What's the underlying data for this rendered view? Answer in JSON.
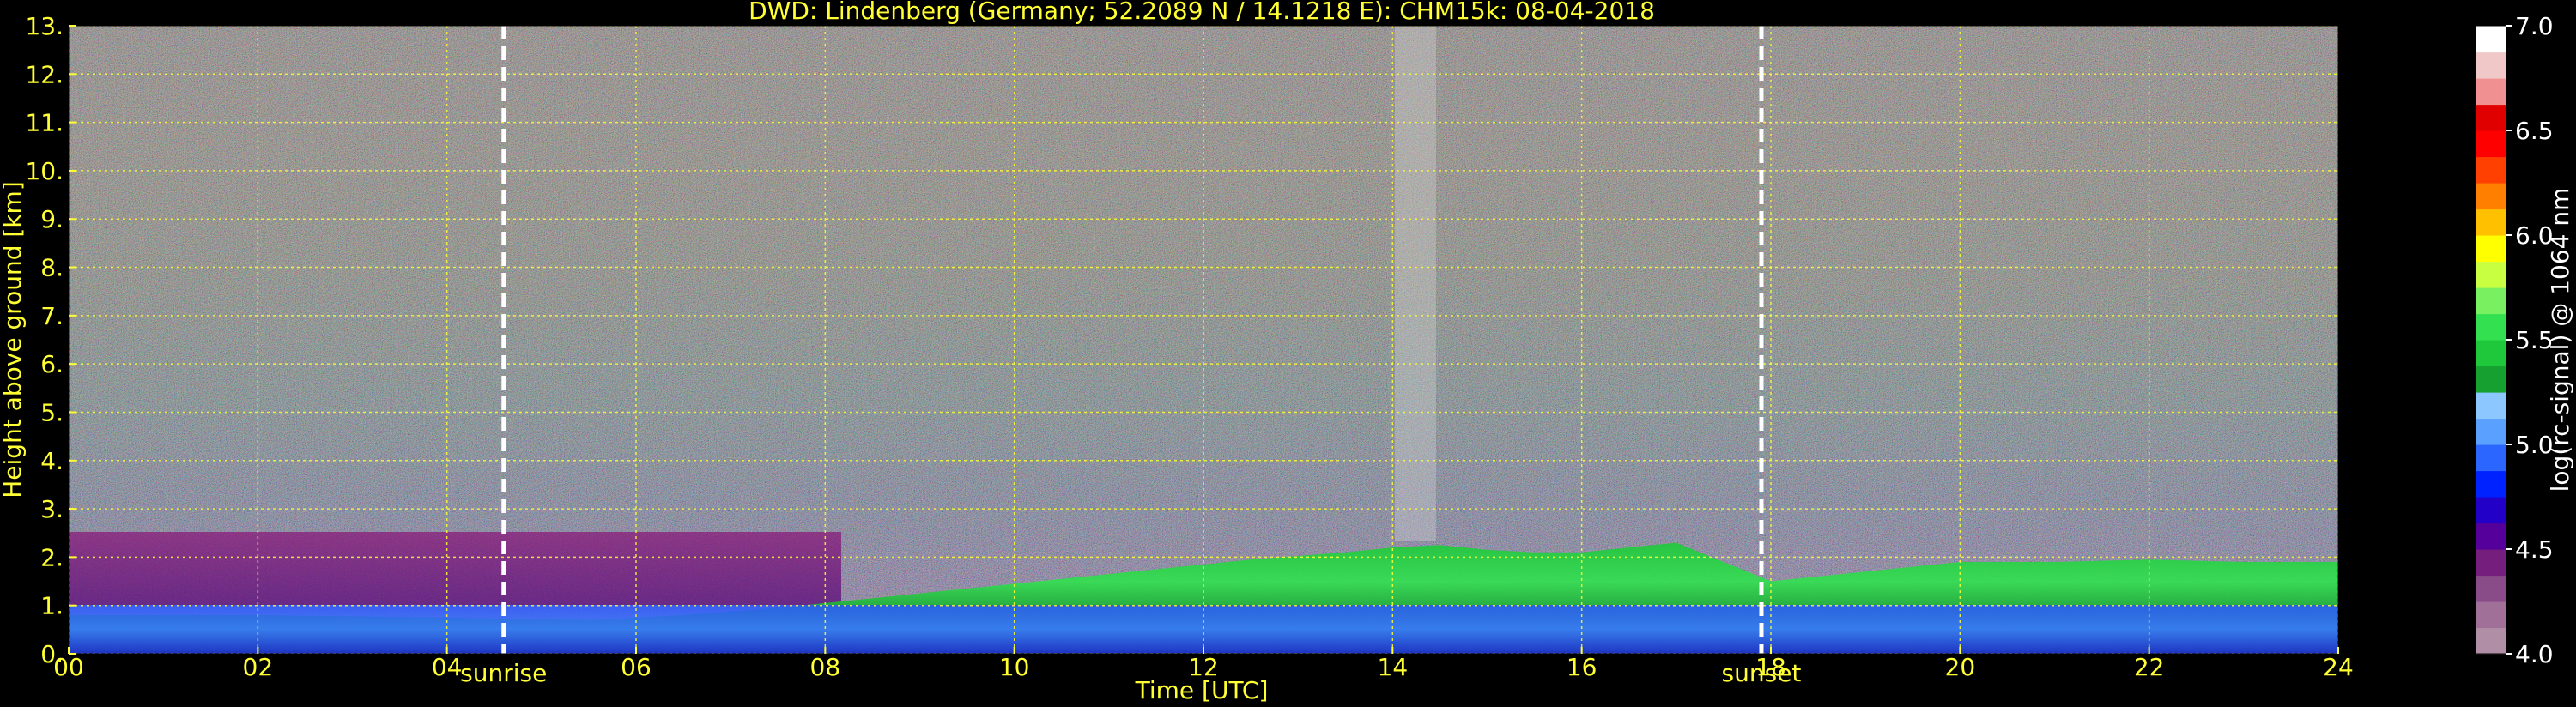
{
  "chart_data": {
    "type": "heatmap",
    "title": "DWD: Lindenberg (Germany; 52.2089 N / 14.1218 E):    CHM15k: 08-04-2018",
    "xlabel": "Time [UTC]",
    "ylabel": "Height above ground [km]",
    "xlim": [
      0,
      24
    ],
    "ylim": [
      0,
      13
    ],
    "x_ticks": [
      0,
      2,
      4,
      6,
      8,
      10,
      12,
      14,
      16,
      18,
      20,
      22,
      24
    ],
    "x_tick_labels": [
      "00",
      "02",
      "04",
      "06",
      "08",
      "10",
      "12",
      "14",
      "16",
      "18",
      "20",
      "22",
      "24"
    ],
    "y_ticks": [
      0,
      1,
      2,
      3,
      4,
      5,
      6,
      7,
      8,
      9,
      10,
      11,
      12,
      13
    ],
    "y_tick_labels": [
      "0.",
      "1.",
      "2.",
      "3.",
      "4.",
      "5.",
      "6.",
      "7.",
      "8.",
      "9.",
      "10.",
      "11.",
      "12.",
      "13."
    ],
    "grid": true,
    "colorbar": {
      "label": "log(rc-signal) @ 1064 nm",
      "range": [
        4.0,
        7.0
      ],
      "ticks": [
        4.0,
        4.5,
        5.0,
        5.5,
        6.0,
        6.5,
        7.0
      ],
      "tick_labels": [
        "4.0",
        "4.5",
        "5.0",
        "5.5",
        "6.0",
        "6.5",
        "7.0"
      ],
      "colors": [
        "#b08fa6",
        "#a07098",
        "#8a4c88",
        "#761e7e",
        "#55009a",
        "#2200c8",
        "#0022ff",
        "#2a66ff",
        "#5aa0ff",
        "#8cc8ff",
        "#16a030",
        "#1ec83a",
        "#32e050",
        "#78f060",
        "#c8ff40",
        "#ffff00",
        "#ffc000",
        "#ff8000",
        "#ff4000",
        "#ff0000",
        "#e00000",
        "#f09090",
        "#f0c8c8",
        "#ffffff"
      ]
    },
    "annotations": [
      {
        "text": "sunrise",
        "x": 4.6
      },
      {
        "text": "sunset",
        "x": 17.9
      }
    ],
    "boundary_layer_top_km": {
      "x": [
        0,
        2,
        4,
        5.5,
        6.5,
        7.5,
        8.5,
        9.5,
        10.5,
        11.5,
        12.5,
        13.5,
        14,
        14.5,
        15,
        15.5,
        16,
        16.5,
        17,
        17.5,
        18,
        19,
        20,
        21,
        22,
        23,
        24
      ],
      "y": [
        0.8,
        0.8,
        0.75,
        0.7,
        0.8,
        0.95,
        1.15,
        1.35,
        1.55,
        1.75,
        1.95,
        2.1,
        2.2,
        2.25,
        2.15,
        2.1,
        2.1,
        2.2,
        2.3,
        1.9,
        1.5,
        1.7,
        1.9,
        1.9,
        1.95,
        1.9,
        1.9
      ]
    }
  }
}
